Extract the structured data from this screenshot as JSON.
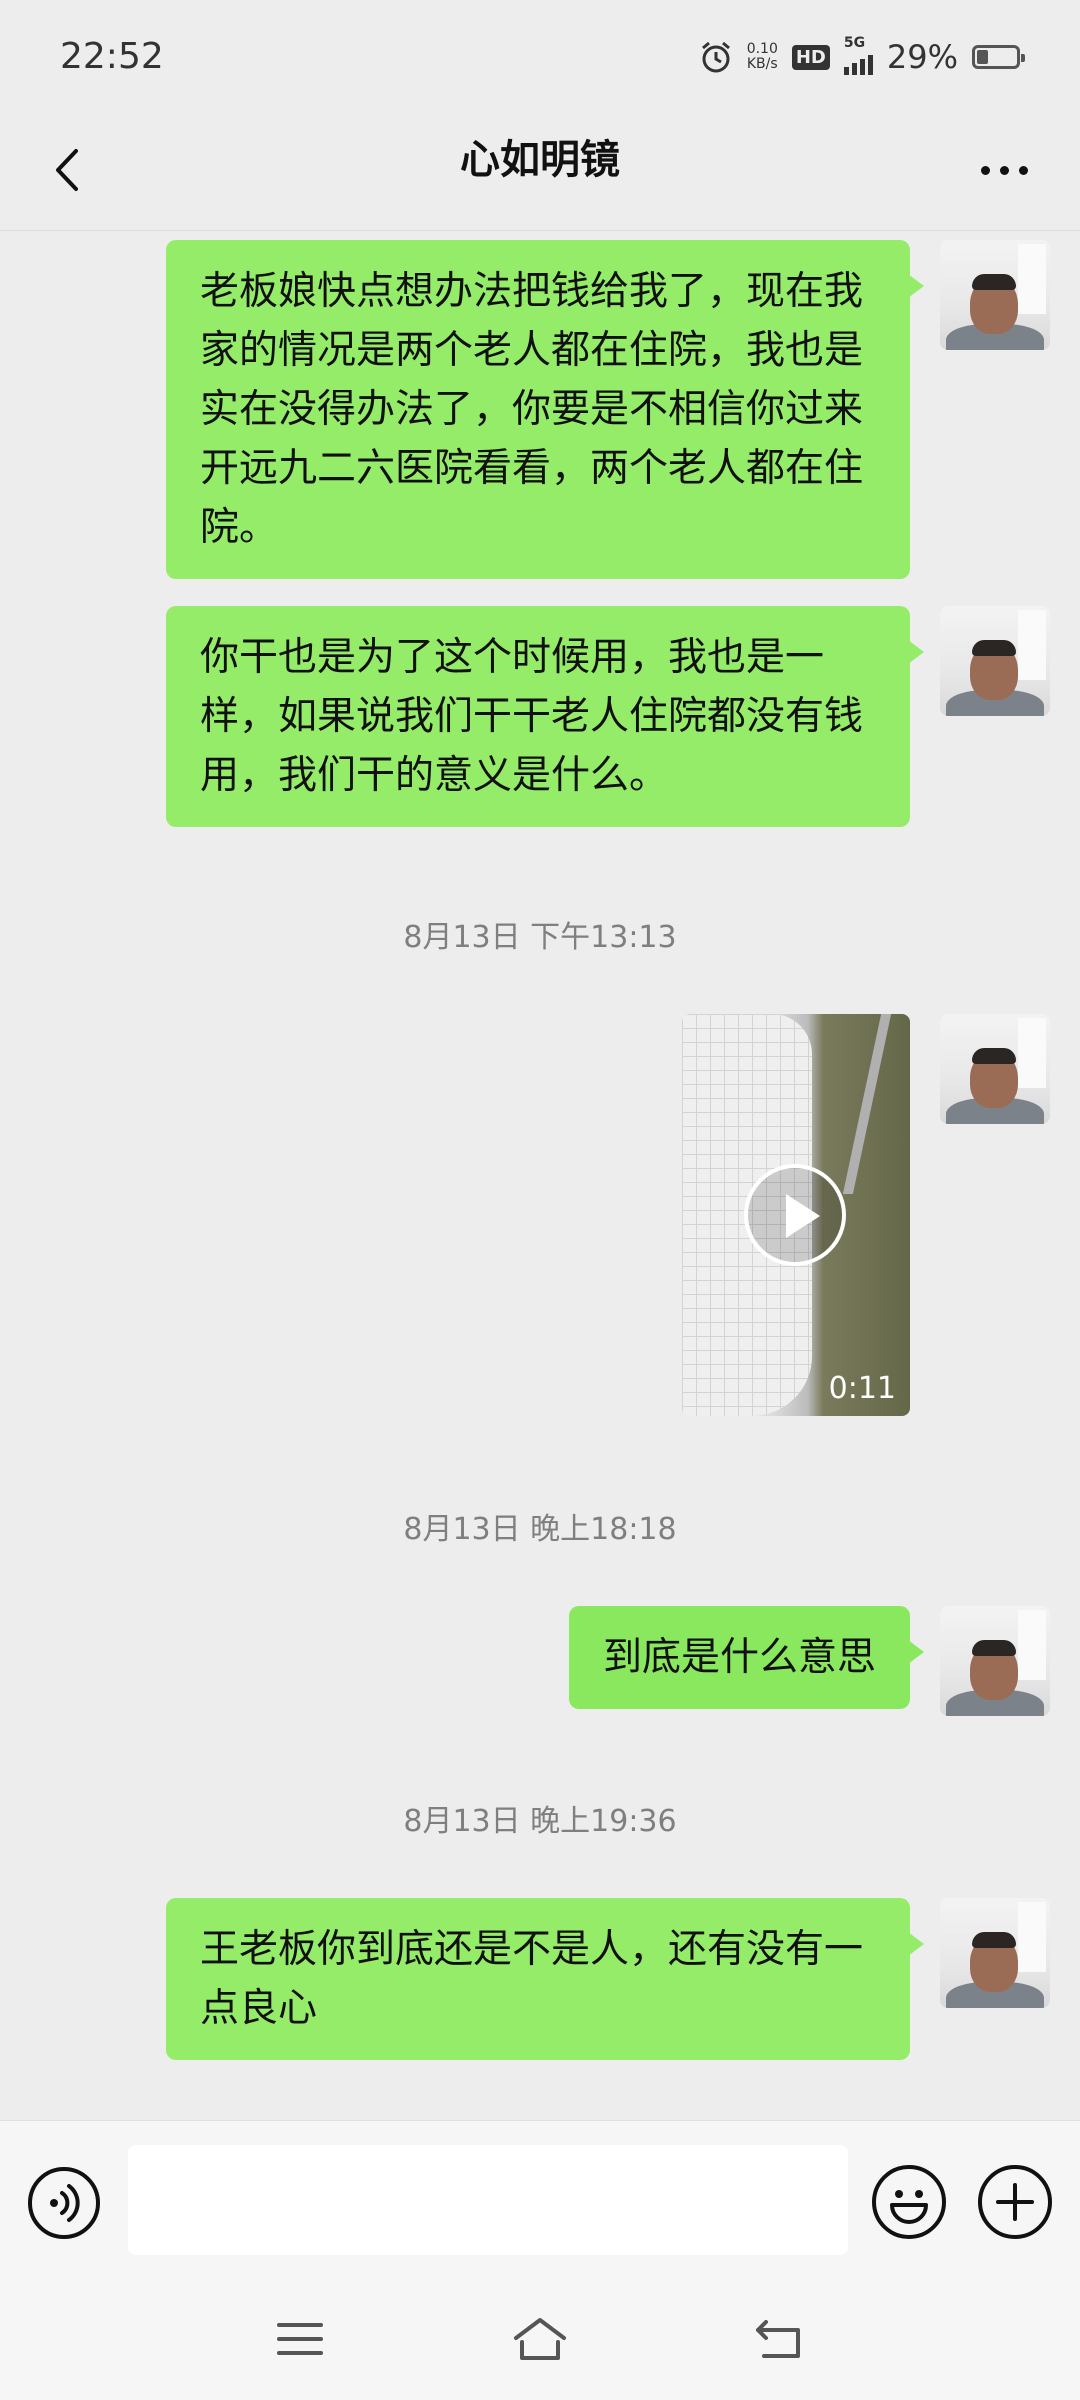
{
  "status_bar": {
    "time": "22:52",
    "net_speed_value": "0.10",
    "net_speed_unit": "KB/s",
    "hd_badge": "HD",
    "network": "5G",
    "battery_percent": "29%",
    "battery_level": 0.29
  },
  "header": {
    "title": "心如明镜"
  },
  "messages": [
    {
      "type": "text",
      "side": "right",
      "text": "老板娘快点想办法把钱给我了，现在我家的情况是两个老人都在住院，我也是实在没得办法了，你要是不相信你过来开远九二六医院看看，两个老人都在住院。"
    },
    {
      "type": "text",
      "side": "right",
      "text": "你干也是为了这个时候用，我也是一样，如果说我们干干老人住院都没有钱用，我们干的意义是什么。"
    },
    {
      "type": "timestamp",
      "text": "8月13日 下午13:13"
    },
    {
      "type": "video",
      "side": "right",
      "duration": "0:11"
    },
    {
      "type": "timestamp",
      "text": "8月13日 晚上18:18"
    },
    {
      "type": "text",
      "side": "right",
      "text": "到底是什么意思"
    },
    {
      "type": "timestamp",
      "text": "8月13日 晚上19:36"
    },
    {
      "type": "text",
      "side": "right",
      "text": "王老板你到底还是不是人，还有没有一点良心"
    }
  ],
  "input_bar": {
    "message_value": "",
    "icons": [
      "voice-icon",
      "emoji-icon",
      "plus-icon"
    ]
  },
  "nav_bar": {
    "icons": [
      "menu-icon",
      "home-icon",
      "back-icon"
    ]
  },
  "colors": {
    "background": "#ededed",
    "bubble_green": "#95ec69",
    "timestamp_gray": "#7f7f7f"
  }
}
